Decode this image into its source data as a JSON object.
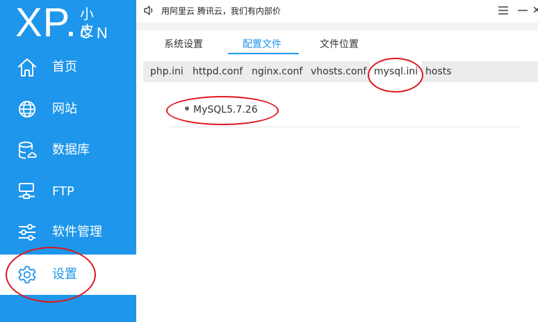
{
  "logo": {
    "main": "XP",
    "dot": ".",
    "small": "小皮",
    "cn": "CN"
  },
  "topbar": {
    "notice": "用阿里云 腾讯云，我们有内部价"
  },
  "sidebar": {
    "items": [
      {
        "label": "首页",
        "icon": "home-icon"
      },
      {
        "label": "网站",
        "icon": "globe-icon"
      },
      {
        "label": "数据库",
        "icon": "database-icon"
      },
      {
        "label": "FTP",
        "icon": "ftp-icon"
      },
      {
        "label": "软件管理",
        "icon": "sliders-icon"
      },
      {
        "label": "设置",
        "icon": "gear-icon",
        "active": true
      }
    ]
  },
  "tabs": [
    {
      "label": "系统设置"
    },
    {
      "label": "配置文件",
      "active": true
    },
    {
      "label": "文件位置"
    }
  ],
  "subtabs": [
    {
      "label": "php.ini"
    },
    {
      "label": "httpd.conf"
    },
    {
      "label": "nginx.conf"
    },
    {
      "label": "vhosts.conf"
    },
    {
      "label": "mysql.ini",
      "active": true
    },
    {
      "label": "hosts"
    }
  ],
  "content": {
    "versions": [
      "MySQL5.7.26"
    ]
  },
  "colors": {
    "accent": "#1e96eb",
    "annotation": "#e2141b"
  }
}
